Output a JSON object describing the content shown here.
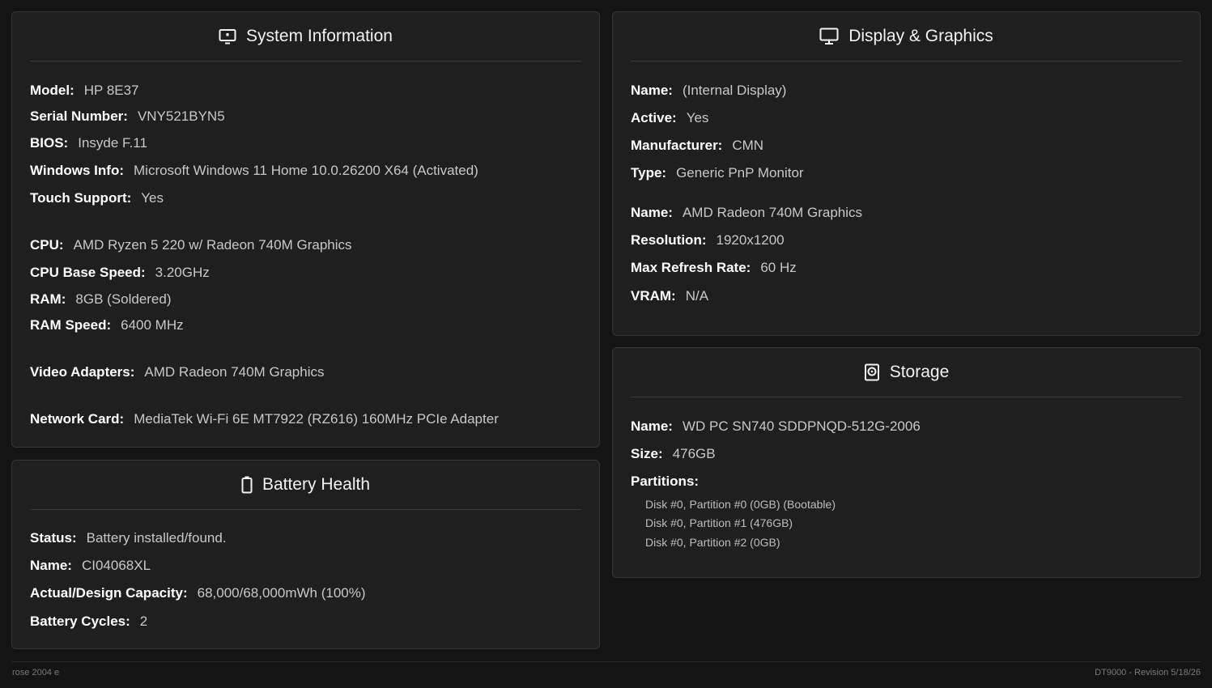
{
  "system": {
    "title": "System Information",
    "rows": [
      {
        "label": "Model:",
        "value": "HP 8E37"
      },
      {
        "label": "Serial Number:",
        "value": "VNY521BYN5"
      },
      {
        "label": "BIOS:",
        "value": "Insyde F.11"
      },
      {
        "label": "Windows Info:",
        "value": "Microsoft Windows 11 Home 10.0.26200 X64 (Activated)"
      },
      {
        "label": "Touch Support:",
        "value": "Yes"
      },
      {
        "label": "CPU:",
        "value": "AMD Ryzen 5 220 w/ Radeon 740M Graphics"
      },
      {
        "label": "CPU Base Speed:",
        "value": "3.20GHz"
      },
      {
        "label": "RAM:",
        "value": "8GB (Soldered)"
      },
      {
        "label": "RAM Speed:",
        "value": "6400 MHz"
      },
      {
        "label": "Video Adapters:",
        "value": "AMD Radeon 740M Graphics"
      },
      {
        "label": "Network Card:",
        "value": "MediaTek Wi-Fi 6E MT7922 (RZ616) 160MHz PCIe Adapter"
      }
    ]
  },
  "battery": {
    "title": "Battery Health",
    "rows": [
      {
        "label": "Status:",
        "value": "Battery installed/found."
      },
      {
        "label": "Name:",
        "value": "CI04068XL"
      },
      {
        "label": "Actual/Design Capacity:",
        "value": "68,000/68,000mWh (100%)"
      },
      {
        "label": "Battery Cycles:",
        "value": "2"
      }
    ]
  },
  "display": {
    "title": "Display & Graphics",
    "rows": [
      {
        "label": "Name:",
        "value": "(Internal Display)"
      },
      {
        "label": "Active:",
        "value": "Yes"
      },
      {
        "label": "Manufacturer:",
        "value": "CMN"
      },
      {
        "label": "Type:",
        "value": "Generic PnP Monitor"
      },
      {
        "label": "Name:",
        "value": "AMD Radeon 740M Graphics"
      },
      {
        "label": "Resolution:",
        "value": "1920x1200"
      },
      {
        "label": "Max Refresh Rate:",
        "value": "60 Hz"
      },
      {
        "label": "VRAM:",
        "value": "N/A"
      }
    ]
  },
  "storage": {
    "title": "Storage",
    "rows": [
      {
        "label": "Name:",
        "value": "WD PC SN740 SDDPNQD-512G-2006"
      },
      {
        "label": "Size:",
        "value": "476GB"
      },
      {
        "label": "Partitions:",
        "value": ""
      }
    ],
    "partitions": [
      "Disk #0, Partition #0 (0GB) (Bootable)",
      "Disk #0, Partition #1 (476GB)",
      "Disk #0, Partition #2 (0GB)"
    ]
  },
  "footer": {
    "left": "rose 2004 e",
    "right": "DT9000 - Revision 5/18/26"
  },
  "icons": {
    "system": "computer-info-icon",
    "display": "monitor-icon",
    "battery": "battery-icon",
    "storage": "disk-icon"
  }
}
